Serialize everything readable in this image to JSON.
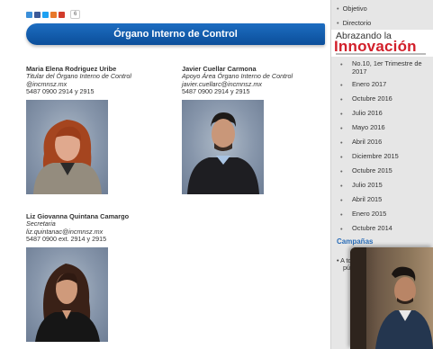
{
  "share": {
    "colors": [
      "#3b8fd9",
      "#3b5998",
      "#1da1f2",
      "#e8782a",
      "#d23b2b"
    ],
    "count": "6"
  },
  "page_title": "Órgano Interno de Control",
  "people": [
    {
      "name": "Maria Elena Rodriguez Uribe",
      "role": "Titular del Órgano Interno de Control",
      "email": "@incmnsz.mx",
      "phone": "5487 0900 2914 y 2915"
    },
    {
      "name": "Javier Cuellar Carmona",
      "role": "Apoyo Área Órgano Interno de Control",
      "email": "javier.cuellarc@incmnsz.mx",
      "phone": "5487 0900 2914 y 2915"
    },
    {
      "name": "Liz Giovanna Quintana Camargo",
      "role": "Secretaria",
      "email": "liz.quintanac@incmnsz.mx",
      "phone": "5487 0900 ext. 2914 y 2915"
    }
  ],
  "sidebar": {
    "top_links": [
      "Objetivo",
      "Directorio"
    ],
    "banner": {
      "line1": "Abrazando la",
      "line2": "Innovación"
    },
    "issues": [
      "No.10, 1er Trimestre de 2017",
      "Enero 2017",
      "Octubre 2016",
      "Julio 2016",
      "Mayo 2016",
      "Abril 2016",
      "Diciembre 2015",
      "Octubre 2015",
      "Julio 2015",
      "Abril 2015",
      "Enero 2015",
      "Octubre 2014"
    ],
    "campaigns_label": "Campañas",
    "bottom_partial": [
      "A to",
      "púb"
    ]
  },
  "icons": {
    "bullet": "•"
  }
}
